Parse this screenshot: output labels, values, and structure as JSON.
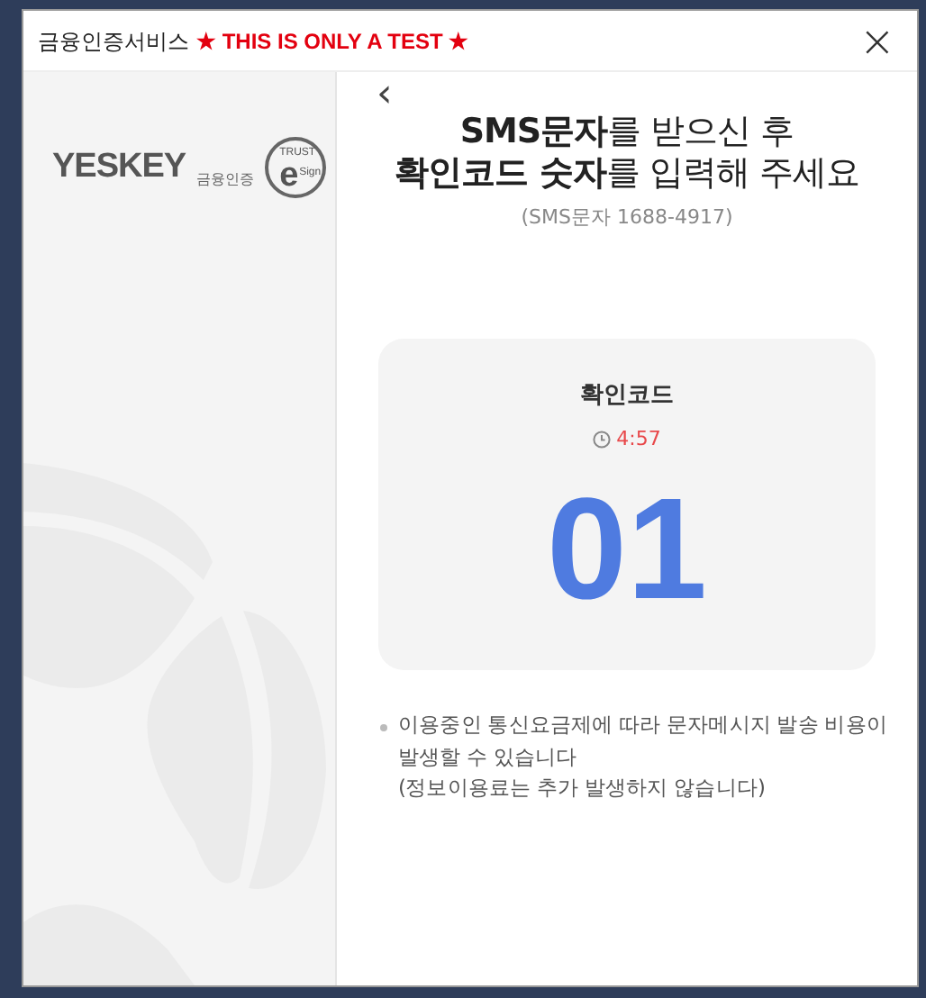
{
  "window": {
    "title": "금융인증서비스",
    "test_notice": "★ THIS IS ONLY A TEST ★",
    "close_icon": "×"
  },
  "sidebar": {
    "logo": {
      "wordmark": "YESKEY",
      "wordmark_sub": "금융인증",
      "seal_top": "TRUST",
      "seal_letter": "e",
      "seal_side": "Sign"
    }
  },
  "main": {
    "back": "‹",
    "heading": [
      "**SMS문자**를 받으신 후",
      "**확인코드 숫자**를 입력해 주세요"
    ],
    "subheading": "(SMS문자 1688-4917)",
    "code_card": {
      "label": "확인코드",
      "timer": "4:57",
      "code": "01"
    },
    "notes": [
      {
        "text": "이용중인 통신요금제에 따라 문자메시지 발송 비용이 발생할 수 있습니다",
        "bullet": true
      },
      {
        "text": "(정보이용료는 추가 발생하지 않습니다)",
        "bullet": false
      }
    ]
  }
}
